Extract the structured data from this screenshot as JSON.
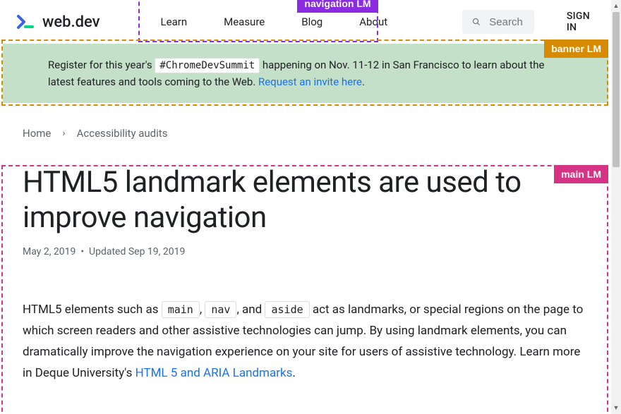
{
  "header": {
    "logo_text": "web.dev",
    "nav": [
      "Learn",
      "Measure",
      "Blog",
      "About"
    ],
    "search_placeholder": "Search",
    "signin": "SIGN IN"
  },
  "banner": {
    "pre": "Register for this year's ",
    "hashtag": "#ChromeDevSummit",
    "mid": " happening on Nov. 11-12 in San Francisco to learn about the latest features and tools coming to the Web. ",
    "link": "Request an invite here",
    "post": "."
  },
  "breadcrumb": {
    "items": [
      "Home",
      "Accessibility audits"
    ]
  },
  "article": {
    "title": "HTML5 landmark elements are used to improve navigation",
    "meta": "May 2, 2019  •  Updated Sep 19, 2019",
    "p1_a": "HTML5 elements such as ",
    "code1": "main",
    "p1_b": ", ",
    "code2": "nav",
    "p1_c": ", and ",
    "code3": "aside",
    "p1_d": " act as landmarks, or special regions on the page to which screen readers and other assistive technologies can jump. By using landmark elements, you can dramatically improve the navigation experience on your site for users of assistive technology. Learn more in Deque University's ",
    "link1": "HTML 5 and ARIA Landmarks",
    "p1_e": "."
  },
  "landmarks": {
    "nav": "navigation LM",
    "banner": "banner LM",
    "main": "main LM"
  }
}
